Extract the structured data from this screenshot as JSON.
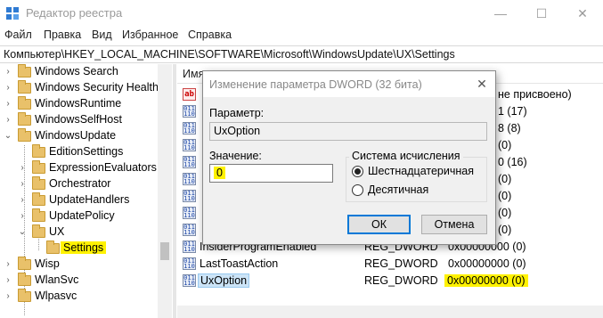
{
  "window": {
    "title": "Редактор реестра",
    "minimize": "—",
    "maximize": "☐",
    "close": "✕"
  },
  "menu": [
    "Файл",
    "Правка",
    "Вид",
    "Избранное",
    "Справка"
  ],
  "address": "Компьютер\\HKEY_LOCAL_MACHINE\\SOFTWARE\\Microsoft\\WindowsUpdate\\UX\\Settings",
  "tree": {
    "items": [
      {
        "label": "Windows Search",
        "expander": "›"
      },
      {
        "label": "Windows Security Health",
        "expander": "›"
      },
      {
        "label": "WindowsRuntime",
        "expander": "›"
      },
      {
        "label": "WindowsSelfHost",
        "expander": "›"
      },
      {
        "label": "WindowsUpdate",
        "expander": "⌄"
      },
      {
        "label": "EditionSettings",
        "expander": ""
      },
      {
        "label": "ExpressionEvaluators",
        "expander": "›"
      },
      {
        "label": "Orchestrator",
        "expander": "›"
      },
      {
        "label": "UpdateHandlers",
        "expander": "›"
      },
      {
        "label": "UpdatePolicy",
        "expander": "›"
      },
      {
        "label": "UX",
        "expander": "⌄"
      },
      {
        "label": "Settings",
        "expander": "",
        "selected": true
      },
      {
        "label": "Wisp",
        "expander": "›"
      },
      {
        "label": "WlanSvc",
        "expander": "›"
      },
      {
        "label": "Wlpasvc",
        "expander": "›"
      }
    ]
  },
  "list": {
    "header_name": "Имя",
    "partial": [
      "не присвоено)",
      "1 (17)",
      "8 (8)",
      "(0)",
      "0 (16)",
      "(0)",
      "(0)",
      "(0)",
      "(0)"
    ],
    "rows": [
      {
        "name": "InsiderProgramEnabled",
        "type": "REG_DWORD",
        "data": "0x00000000 (0)"
      },
      {
        "name": "LastToastAction",
        "type": "REG_DWORD",
        "data": "0x00000000 (0)"
      },
      {
        "name": "UxOption",
        "type": "REG_DWORD",
        "data": "0x00000000 (0)",
        "selected": true
      }
    ],
    "icon_ab_text": "ab",
    "icon_bin_text": "011\n110"
  },
  "dialog": {
    "title": "Изменение параметра DWORD (32 бита)",
    "close": "✕",
    "param_label": "Параметр:",
    "param_value": "UxOption",
    "value_label": "Значение:",
    "value": "0",
    "base_title": "Система исчисления",
    "hex_label": "Шестнадцатеричная",
    "dec_label": "Десятичная",
    "ok": "ОК",
    "cancel": "Отмена"
  },
  "colors": {
    "highlight": "#fff200",
    "selection": "#cce4f7",
    "accent": "#0078d7"
  }
}
